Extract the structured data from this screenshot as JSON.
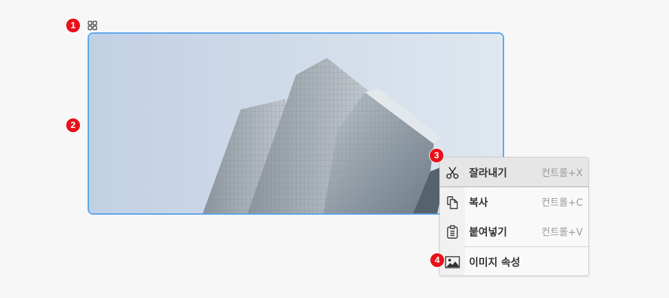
{
  "badges": [
    "1",
    "2",
    "3",
    "4"
  ],
  "context_menu": {
    "items": [
      {
        "label": "잘라내기",
        "shortcut": "컨트롤+X",
        "icon": "scissors-icon"
      },
      {
        "label": "복사",
        "shortcut": "컨트롤+C",
        "icon": "copy-icon"
      },
      {
        "label": "붙여넣기",
        "shortcut": "컨트롤+V",
        "icon": "paste-icon"
      },
      {
        "label": "이미지 속성",
        "shortcut": "",
        "icon": "image-icon"
      }
    ]
  },
  "colors": {
    "badge": "#e8101b",
    "selection_border": "#5aa4ec",
    "menu_highlight": "#e6e6e6"
  }
}
